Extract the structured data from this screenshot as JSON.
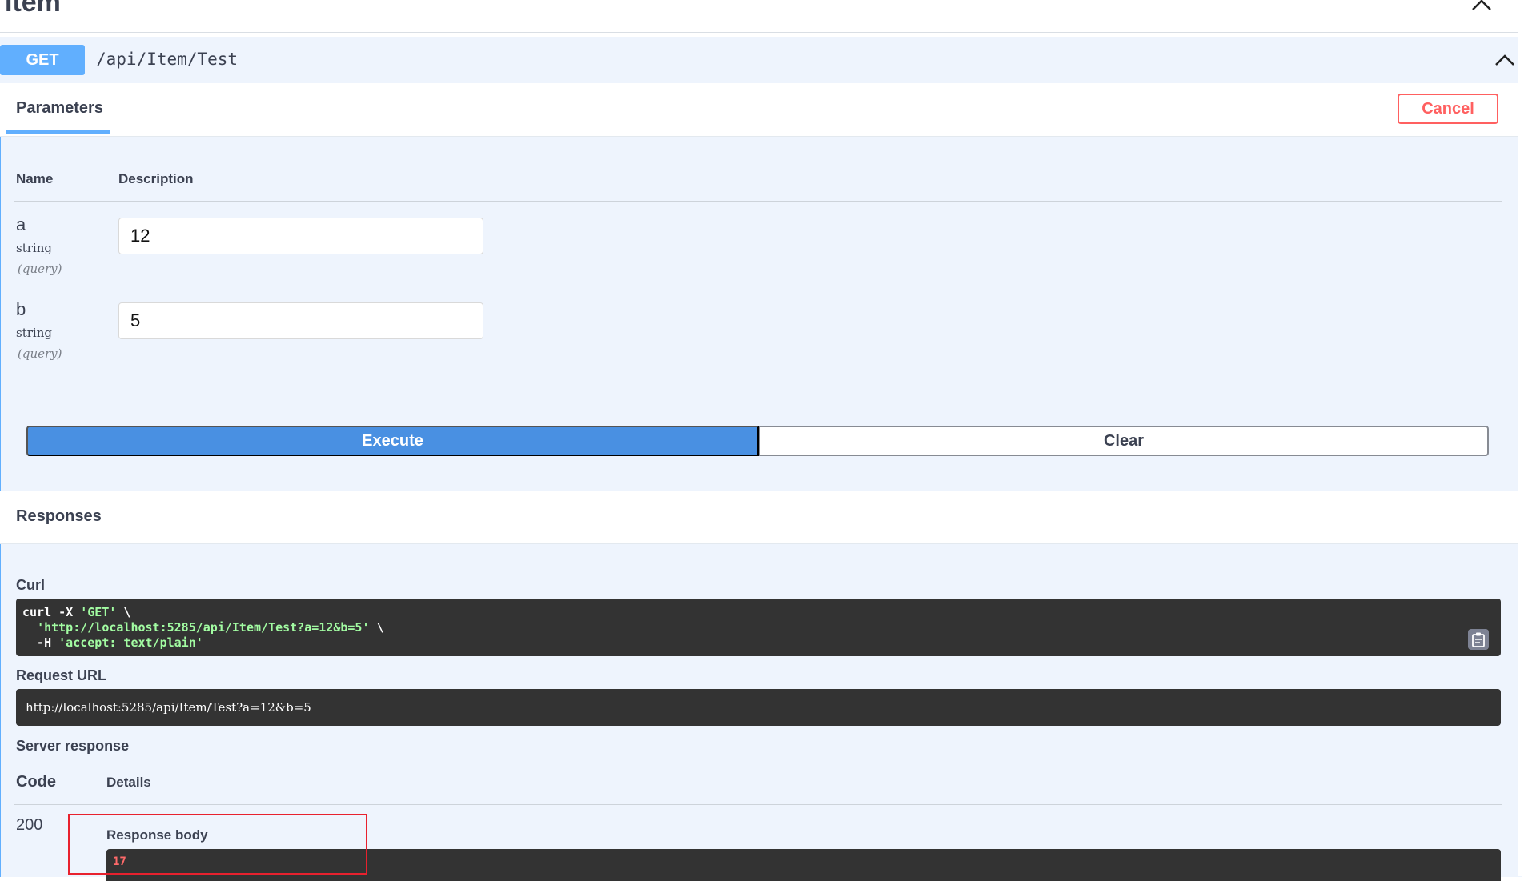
{
  "tag": {
    "title": "Item"
  },
  "operation": {
    "method": "GET",
    "path": "/api/Item/Test"
  },
  "parameters_section": {
    "tab_label": "Parameters",
    "cancel_label": "Cancel",
    "column_name": "Name",
    "column_description": "Description",
    "items": [
      {
        "name": "a",
        "type": "string",
        "in": "(query)",
        "value": "12"
      },
      {
        "name": "b",
        "type": "string",
        "in": "(query)",
        "value": "5"
      }
    ],
    "execute_label": "Execute",
    "clear_label": "Clear"
  },
  "responses_section": {
    "title": "Responses",
    "curl_label": "Curl",
    "curl": {
      "line1_cmd": "curl -X ",
      "line1_str": "'GET'",
      "line1_tail": " \\",
      "line2_str": "'http://localhost:5285/api/Item/Test?a=12&b=5'",
      "line2_tail": " \\",
      "line3_cmd": "  -H ",
      "line3_str": "'accept: text/plain'"
    },
    "request_url_label": "Request URL",
    "request_url": "http://localhost:5285/api/Item/Test?a=12&b=5",
    "server_response_label": "Server response",
    "code_header": "Code",
    "details_header": "Details",
    "code": "200",
    "response_body_label": "Response body",
    "response_body": "17"
  },
  "colors": {
    "get_blue": "#61affe",
    "execute_blue": "#4990e2",
    "cancel_red": "#ff6060",
    "highlight_red": "#e8212e",
    "code_bg": "#333333"
  },
  "icons": {
    "tag_collapse": "chevron-up-icon",
    "op_collapse": "chevron-up-icon",
    "copy": "clipboard-icon"
  }
}
